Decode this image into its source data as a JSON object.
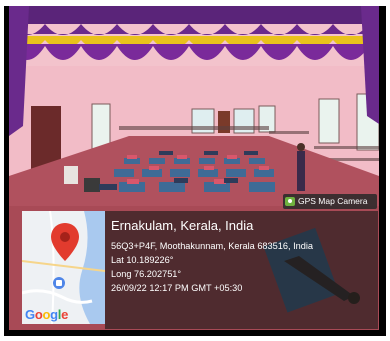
{
  "overlay": {
    "app_label": "GPS Map Camera",
    "app_icon": "camera-icon",
    "location_title": "Ernakulam, Kerala, India",
    "address": "56Q3+P4F, Moothakunnam, Kerala 683516, India",
    "latitude": "Lat 10.189226°",
    "longitude": "Long 76.202751°",
    "datetime": "26/09/22 12:17 PM GMT +05:30"
  },
  "map": {
    "logo_text": "Google",
    "marker_icon": "map-pin-icon",
    "place_icon": "place-marker-icon",
    "logo_colors": [
      "#4285F4",
      "#EA4335",
      "#FBBC05",
      "#4285F4",
      "#34A853",
      "#EA4335"
    ]
  },
  "scene": {
    "curtain_colors": [
      "#6a2a8c",
      "#e9c21c"
    ],
    "wall_color": "#f2bcc7",
    "floor_color": "#a84a56",
    "mat_color": "#3f6b96"
  }
}
